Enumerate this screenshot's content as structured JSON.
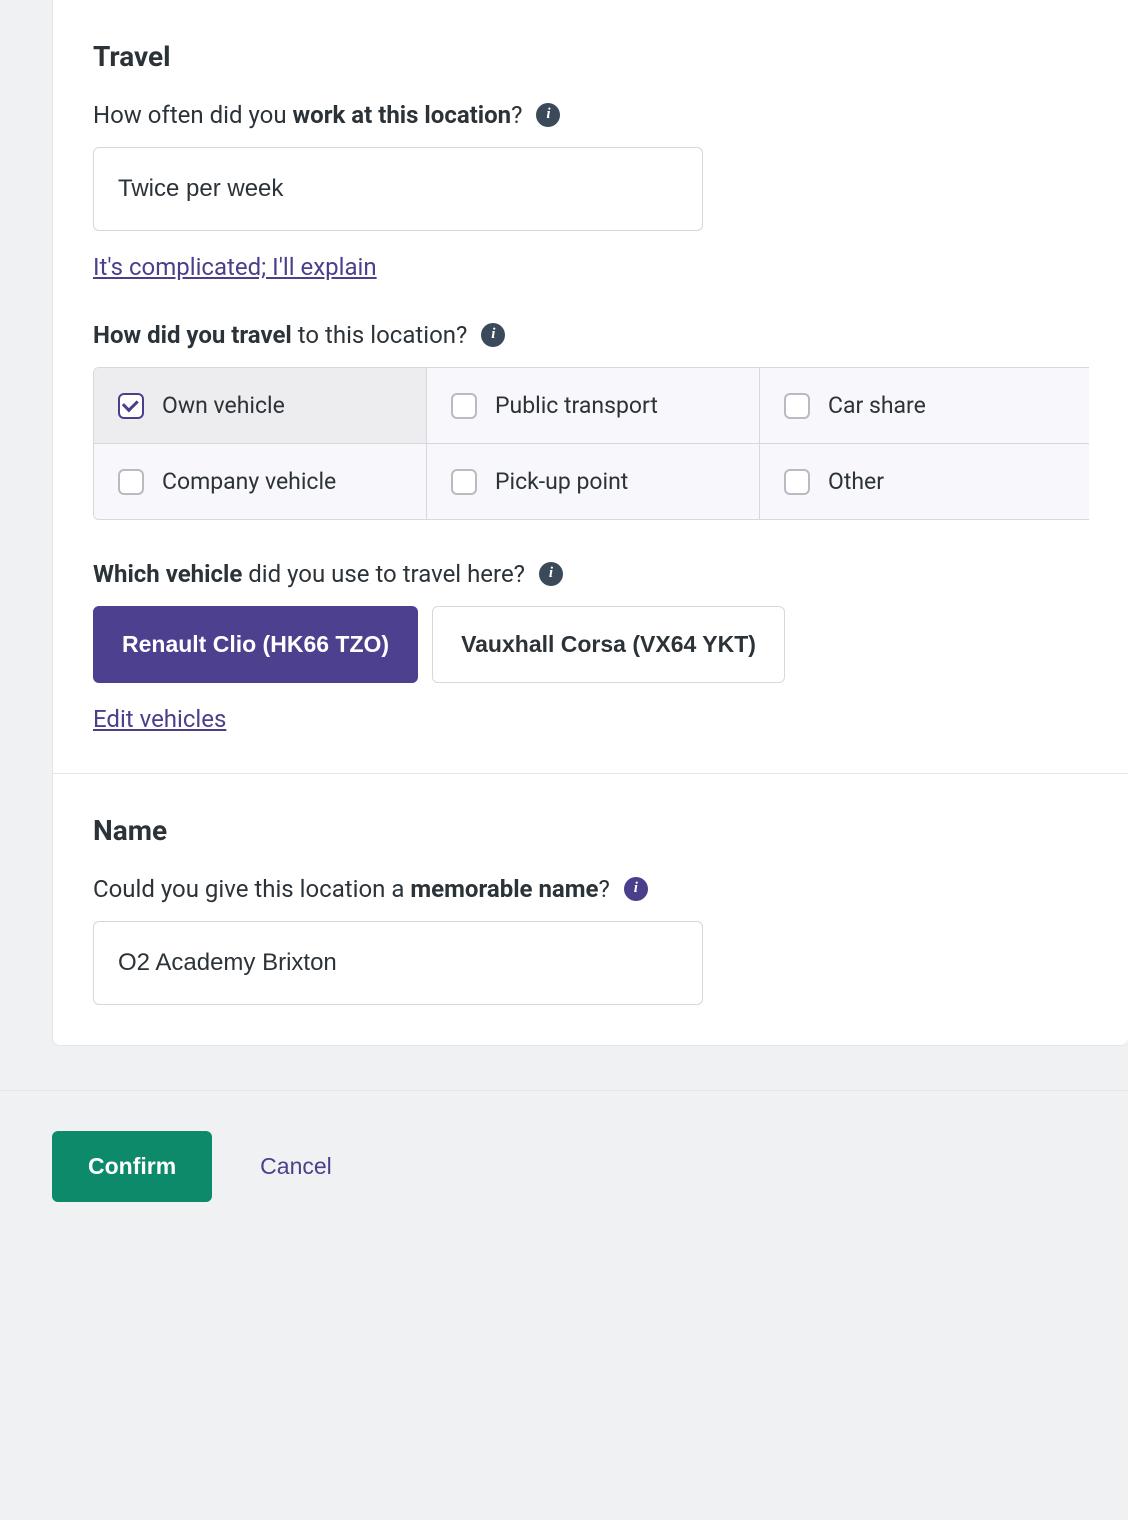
{
  "travel": {
    "title": "Travel",
    "frequency": {
      "label_pre": "How often did you ",
      "label_bold": "work at this location",
      "label_post": "?",
      "value": "Twice per week",
      "alt_link": "It's complicated; I'll explain"
    },
    "mode": {
      "label_bold": "How did you travel",
      "label_post": " to this location?",
      "options": [
        {
          "label": "Own vehicle",
          "checked": true
        },
        {
          "label": "Public transport",
          "checked": false
        },
        {
          "label": "Car share",
          "checked": false
        },
        {
          "label": "Company vehicle",
          "checked": false
        },
        {
          "label": "Pick-up point",
          "checked": false
        },
        {
          "label": "Other",
          "checked": false
        }
      ]
    },
    "vehicle": {
      "label_bold": "Which vehicle",
      "label_post": " did you use to travel here?",
      "options": [
        {
          "label": "Renault Clio (HK66 TZO)",
          "selected": true
        },
        {
          "label": "Vauxhall Corsa (VX64 YKT)",
          "selected": false
        }
      ],
      "edit_link": "Edit vehicles"
    }
  },
  "name": {
    "title": "Name",
    "question_pre": "Could you give this location a ",
    "question_bold": "memorable name",
    "question_post": "?",
    "value": "O2 Academy Brixton"
  },
  "footer": {
    "confirm": "Confirm",
    "cancel": "Cancel"
  }
}
